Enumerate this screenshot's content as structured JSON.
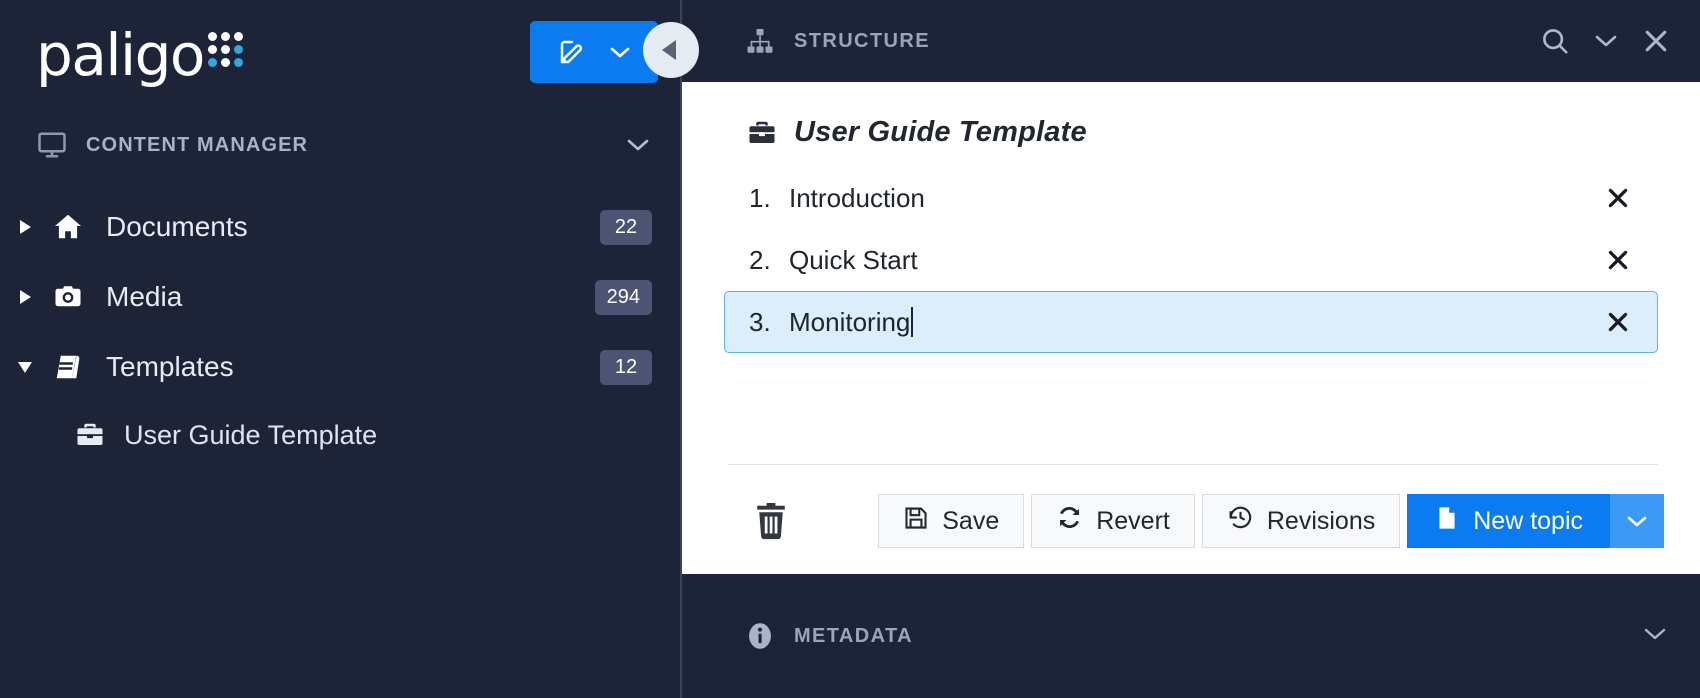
{
  "brand": {
    "name": "paligo",
    "logo_dots": [
      "w",
      "w",
      "w",
      "w",
      "w",
      "b",
      "b",
      "w",
      "b"
    ],
    "accent_blue": "#0a7bf0",
    "logo_dot_blue": "#31a8e0"
  },
  "sidebar": {
    "edit_button": {
      "icon": "edit-pencil-icon",
      "chevron": "chevron-down-icon"
    },
    "section": {
      "label": "CONTENT MANAGER",
      "icon": "monitor-icon",
      "chevron": "chevron-down-icon"
    },
    "tree": [
      {
        "label": "Documents",
        "badge": "22",
        "icon": "home-icon",
        "expanded": false
      },
      {
        "label": "Media",
        "badge": "294",
        "icon": "camera-icon",
        "expanded": false
      },
      {
        "label": "Templates",
        "badge": "12",
        "icon": "book-icon",
        "expanded": true
      }
    ],
    "children": [
      {
        "label": "User Guide Template",
        "icon": "briefcase-icon"
      }
    ]
  },
  "panel": {
    "title": "STRUCTURE",
    "title_icon": "sitemap-icon",
    "collapse_icon": "chevron-left-circle-icon",
    "actions": [
      {
        "name": "search-icon"
      },
      {
        "name": "chevron-down-icon"
      },
      {
        "name": "close-icon"
      }
    ]
  },
  "document": {
    "title": "User Guide Template",
    "title_icon": "briefcase-icon",
    "topics": [
      {
        "num": "1.",
        "name": "Introduction",
        "active": false
      },
      {
        "num": "2.",
        "name": "Quick Start",
        "active": false
      },
      {
        "num": "3.",
        "name": "Monitoring",
        "active": true
      }
    ],
    "remove_icon": "close-icon",
    "highlight_fill": "#dcedfb",
    "highlight_border": "#5cb3ea"
  },
  "toolbar": {
    "delete_icon": "trash-icon",
    "buttons": [
      {
        "label": "Save",
        "icon": "floppy-disk-icon",
        "primary": false
      },
      {
        "label": "Revert",
        "icon": "refresh-icon",
        "primary": false
      },
      {
        "label": "Revisions",
        "icon": "history-clock-icon",
        "primary": false
      },
      {
        "label": "New topic",
        "icon": "new-file-icon",
        "primary": true
      }
    ],
    "dropdown_icon": "chevron-down-icon"
  },
  "metadata": {
    "label": "METADATA",
    "icon": "info-circle-icon",
    "chevron": "chevron-down-icon"
  }
}
